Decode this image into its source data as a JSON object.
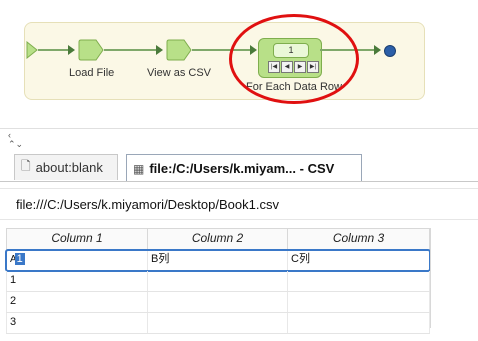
{
  "workflow": {
    "nodes": [
      {
        "label": "Load File",
        "icon": "pentagon-node-icon"
      },
      {
        "label": "View as CSV",
        "icon": "pentagon-node-icon"
      },
      {
        "label": "For Each Data Row",
        "icon": "loop-node-icon"
      }
    ],
    "loop_counter": "1",
    "loop_controls": [
      "|◀",
      "◀",
      "▶",
      "▶|"
    ],
    "highlight_color": "#e01010",
    "node_color": "#b8e088",
    "end_color": "#2b5fa8"
  },
  "tabs": [
    {
      "label": "about:blank",
      "icon": "page-icon",
      "active": false
    },
    {
      "label": "file:/C:/Users/k.miyam... - CSV",
      "icon": "grid-icon",
      "active": true
    }
  ],
  "address": {
    "value": "file:///C:/Users/k.miyamori/Desktop/Book1.csv"
  },
  "table": {
    "headers": [
      "Column 1",
      "Column 2",
      "Column 3"
    ],
    "rows": [
      [
        "A",
        "1",
        "B列",
        "C列"
      ],
      [
        "1",
        "",
        ""
      ],
      [
        "2",
        "",
        ""
      ],
      [
        "3",
        "",
        ""
      ]
    ],
    "selected_color": "#3a78c8"
  }
}
